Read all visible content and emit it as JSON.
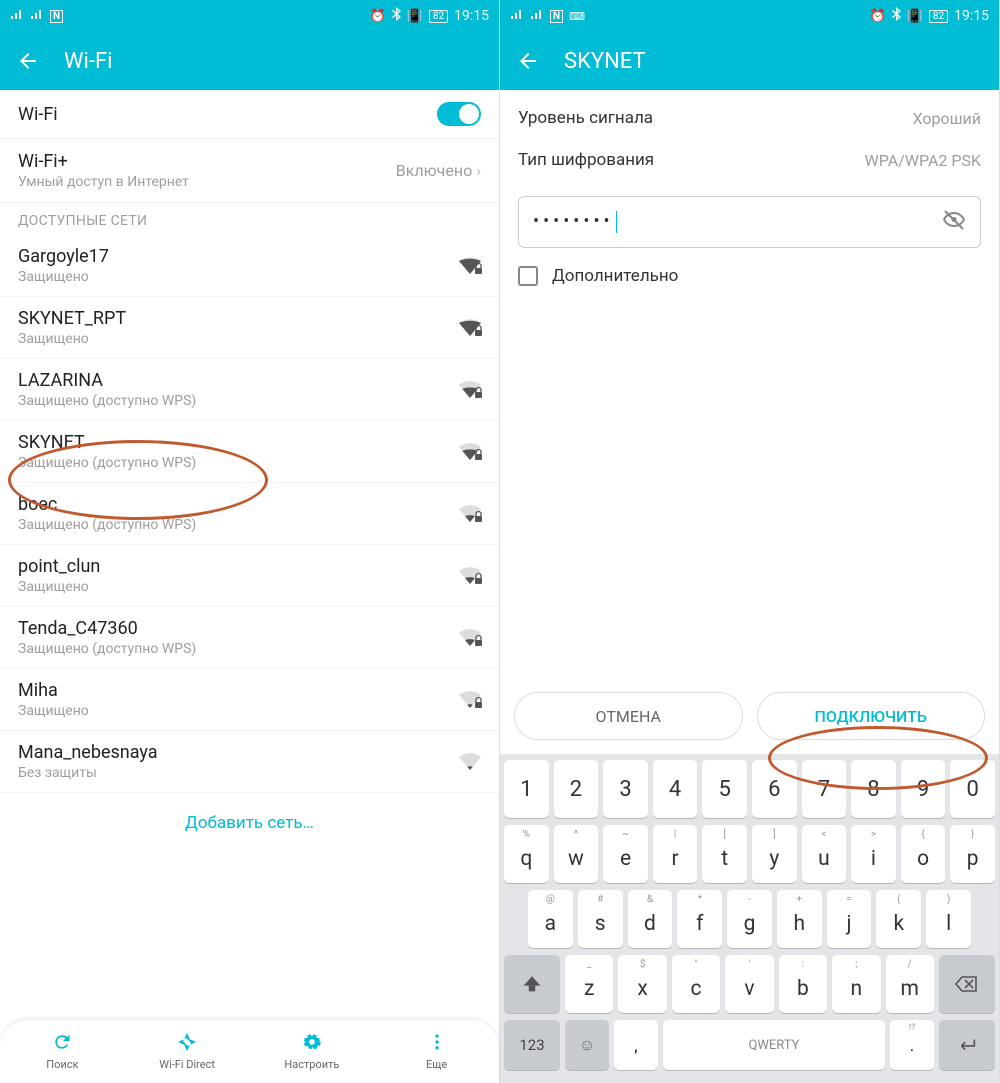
{
  "status": {
    "time": "19:15",
    "battery": "82"
  },
  "left": {
    "header_title": "Wi-Fi",
    "wifi_label": "Wi-Fi",
    "wifiplus_label": "Wi-Fi+",
    "wifiplus_sub": "Умный доступ в Интернет",
    "wifiplus_value": "Включено",
    "section_available": "ДОСТУПНЫЕ СЕТИ",
    "networks": [
      {
        "name": "Gargoyle17",
        "sub": "Защищено",
        "signal": 4,
        "lock": true
      },
      {
        "name": "SKYNET_RPT",
        "sub": "Защищено",
        "signal": 4,
        "lock": true
      },
      {
        "name": "LAZARINA",
        "sub": "Защищено (доступно WPS)",
        "signal": 3,
        "lock": true
      },
      {
        "name": "SKYNET",
        "sub": "Защищено (доступно WPS)",
        "signal": 3,
        "lock": true
      },
      {
        "name": "boec",
        "sub": "Защищено (доступно WPS)",
        "signal": 2,
        "lock": true
      },
      {
        "name": "point_clun",
        "sub": "Защищено",
        "signal": 2,
        "lock": true
      },
      {
        "name": "Tenda_C47360",
        "sub": "Защищено (доступно WPS)",
        "signal": 2,
        "lock": true
      },
      {
        "name": "Miha",
        "sub": "Защищено",
        "signal": 1,
        "lock": true
      },
      {
        "name": "Mana_nebesnaya",
        "sub": "Без защиты",
        "signal": 1,
        "lock": false
      }
    ],
    "add_network": "Добавить сеть…",
    "bottom": [
      {
        "label": "Поиск"
      },
      {
        "label": "Wi-Fi Direct"
      },
      {
        "label": "Настроить"
      },
      {
        "label": "Еще"
      }
    ]
  },
  "right": {
    "header_title": "SKYNET",
    "signal_label": "Уровень сигнала",
    "signal_value": "Хороший",
    "enc_label": "Тип шифрования",
    "enc_value": "WPA/WPA2 PSK",
    "password_mask": "••••••••",
    "advanced_label": "Дополнительно",
    "cancel": "ОТМЕНА",
    "connect": "ПОДКЛЮЧИТЬ"
  },
  "keyboard": {
    "nums": [
      "1",
      "2",
      "3",
      "4",
      "5",
      "6",
      "7",
      "8",
      "9",
      "0"
    ],
    "row1": [
      {
        "m": "q",
        "a": "%"
      },
      {
        "m": "w",
        "a": "^"
      },
      {
        "m": "e",
        "a": "~"
      },
      {
        "m": "r",
        "a": "|"
      },
      {
        "m": "t",
        "a": "["
      },
      {
        "m": "y",
        "a": "]"
      },
      {
        "m": "u",
        "a": "<"
      },
      {
        "m": "i",
        "a": ">"
      },
      {
        "m": "o",
        "a": "{"
      },
      {
        "m": "p",
        "a": "}"
      }
    ],
    "row2": [
      {
        "m": "a",
        "a": "@"
      },
      {
        "m": "s",
        "a": "#"
      },
      {
        "m": "d",
        "a": "&"
      },
      {
        "m": "f",
        "a": "*"
      },
      {
        "m": "g",
        "a": "-"
      },
      {
        "m": "h",
        "a": "+"
      },
      {
        "m": "j",
        "a": "="
      },
      {
        "m": "k",
        "a": "("
      },
      {
        "m": "l",
        "a": ")"
      }
    ],
    "row3": [
      {
        "m": "z",
        "a": "_"
      },
      {
        "m": "x",
        "a": "$"
      },
      {
        "m": "c",
        "a": "\""
      },
      {
        "m": "v",
        "a": "'"
      },
      {
        "m": "b",
        "a": ":"
      },
      {
        "m": "n",
        "a": ";"
      },
      {
        "m": "m",
        "a": "/"
      }
    ],
    "mode_key": "123",
    "space_label": "QWERTY",
    "comma": ","
  }
}
